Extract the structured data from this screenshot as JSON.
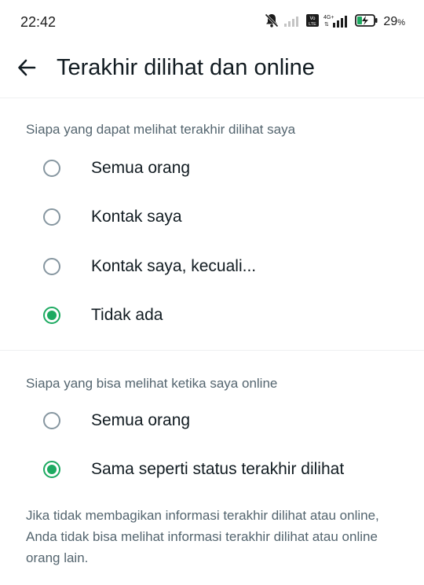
{
  "status_bar": {
    "time": "22:42",
    "network_label": "4G+",
    "volte_label": "Vo LTE",
    "battery_percent": "29",
    "battery_unit": "%",
    "icons": [
      "mute-icon",
      "signal-icon",
      "volte-icon",
      "signal-4g-icon",
      "battery-charging-icon"
    ]
  },
  "top_bar": {
    "back_icon": "arrow-left-icon",
    "title": "Terakhir dilihat dan online"
  },
  "last_seen": {
    "header": "Siapa yang dapat melihat terakhir dilihat saya",
    "options": [
      {
        "label": "Semua orang",
        "checked": false
      },
      {
        "label": "Kontak saya",
        "checked": false
      },
      {
        "label": "Kontak saya, kecuali...",
        "checked": false
      },
      {
        "label": "Tidak ada",
        "checked": true
      }
    ]
  },
  "online": {
    "header": "Siapa yang bisa melihat ketika saya online",
    "options": [
      {
        "label": "Semua orang",
        "checked": false
      },
      {
        "label": "Sama seperti status terakhir dilihat",
        "checked": true
      }
    ]
  },
  "footnote": "Jika tidak membagikan informasi terakhir dilihat atau online, Anda tidak bisa melihat informasi terakhir dilihat atau online orang lain.",
  "colors": {
    "accent": "#1daa61",
    "radio_unchecked": "#8696a0",
    "secondary_text": "#54656f",
    "primary_text": "#111b21"
  }
}
